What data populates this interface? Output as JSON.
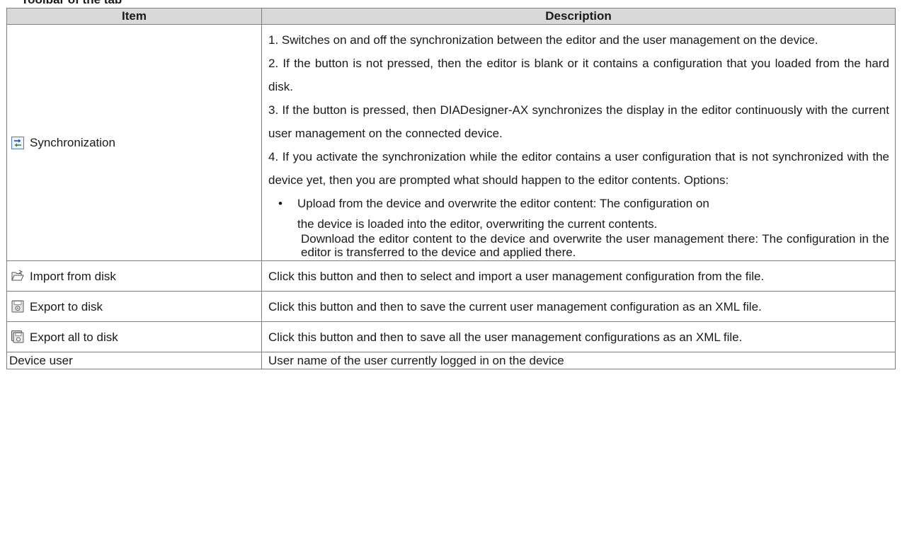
{
  "heading": "Toolbar of the tab",
  "table": {
    "headers": {
      "item": "Item",
      "description": "Description"
    },
    "sync": {
      "icon": "synchronize-icon",
      "label": "Synchronization",
      "p1": "1. Switches on and off the synchronization between the editor and the user management on the device.",
      "p2": "2. If the button is not pressed, then the editor is blank or it contains a configuration that you loaded from the hard disk.",
      "p3": "3. If the button is pressed, then DIADesigner-AX synchronizes the display in the editor continuously with the current user management on the connected device.",
      "p4": "4. If you activate the synchronization while the editor contains a user configuration that is not synchronized with the device yet, then you are prompted what should happen to the editor contents. Options:",
      "bullet1": "Upload from the device and overwrite the editor content: The configuration on",
      "bullet1_cont": "the device is loaded into the editor, overwriting the current contents.",
      "bullet2": "Download the editor content to the device and overwrite the user management there: The configuration in the editor is transferred to the device and applied there."
    },
    "import": {
      "icon": "folder-open-icon",
      "label": "Import from disk",
      "description": "Click this button and then to select and import a user management configuration from the file."
    },
    "export": {
      "icon": "floppy-disk-icon",
      "label": "Export to disk",
      "description": "Click this button and then to save the current user management configuration as an XML file."
    },
    "export_all": {
      "icon": "floppy-disk-stack-icon",
      "label": "Export all to disk",
      "description": "Click this button and then to save all the user management configurations as an XML file."
    },
    "device_user": {
      "label": "Device user",
      "description": "User name of the user currently logged in on the device"
    }
  }
}
